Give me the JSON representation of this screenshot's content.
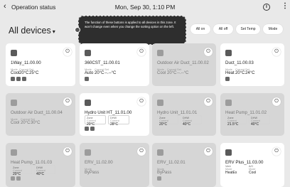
{
  "topbar": {
    "back_icon": "chevron-left-icon",
    "title": "Operation status",
    "datetime": "Mon, Sep 30, 1:10 PM",
    "info_icon": "info-icon",
    "more_icon": "more-vert-icon"
  },
  "header": {
    "title": "All devices"
  },
  "tooltip": {
    "text": "The function of these buttons is applied to all devices in this zone. It won't change even when you change the sorting option on the left."
  },
  "actions": {
    "all_on": "All on",
    "all_off": "All off",
    "set_temp": "Set Temp",
    "mode": "Mode"
  },
  "cards": [
    {
      "name": "1Way_11.00.00",
      "l1": "Mode",
      "l2": "Current",
      "l3": "Set",
      "v1": "Cool",
      "v2": "20°C",
      "v3": "25°C"
    },
    {
      "name": "360CST_11.00.01",
      "l1": "Mode",
      "l2": "Current",
      "l3": "Set",
      "v1": "Auto",
      "v2": "20°C",
      "v3": "--.--°C"
    },
    {
      "name": "Outdoor Air Duct_11.00.02",
      "l1": "Mode",
      "l2": "Current",
      "l3": "Set",
      "v1": "Cool",
      "v2": "20°C",
      "v3": "--.--°C"
    },
    {
      "name": "Duct_11.00.03",
      "l1": "Mode",
      "l2": "Current",
      "l3": "Set",
      "v1": "Heat",
      "v2": "20°C",
      "v3": "24°C"
    },
    {
      "name": "Outdoor Air Duct_11.00.04",
      "l1": "Mode",
      "l2": "Current",
      "l3": "Set",
      "v1": "Cool",
      "v2": "20°C",
      "v3": "30°C"
    },
    {
      "name": "Hydro Unit HT_11.01.00",
      "z1a": "Zone",
      "z1b": "Current",
      "z1c": "20°C",
      "z2a": "DHW",
      "z2b": "Current",
      "z2c": "28°C"
    },
    {
      "name": "Hydro Unit_11.01.01",
      "z1a": "Zone",
      "z1b": "Current",
      "z1c": "20°C",
      "z2a": "DHW",
      "z2b": "Current",
      "z2c": "40°C"
    },
    {
      "name": "Heat Pump_11.01.02",
      "z1a": "Zone",
      "z1b": "Current",
      "z1c": "21.5°C",
      "z2a": "DHW",
      "z2b": "Current",
      "z2c": "40°C"
    },
    {
      "name": "Heat Pump_11.01.03",
      "z1a": "Zone",
      "z1b": "Current",
      "z1c": "20°C",
      "z2a": "DHW",
      "z2b": "Current",
      "z2c": "40°C"
    },
    {
      "name": "ERV_11.02.00",
      "l1": "Mode",
      "v1": "ByPass"
    },
    {
      "name": "ERV_11.02.01",
      "l1": "Mode",
      "v1": "ByPass"
    },
    {
      "name": "ERV Plus_11.03.00",
      "z1a": "Vent",
      "z1b": "Mode",
      "z1c": "HeatEx",
      "z2a": "A/C",
      "z2b": "Mode",
      "z2c": "Cool"
    }
  ]
}
